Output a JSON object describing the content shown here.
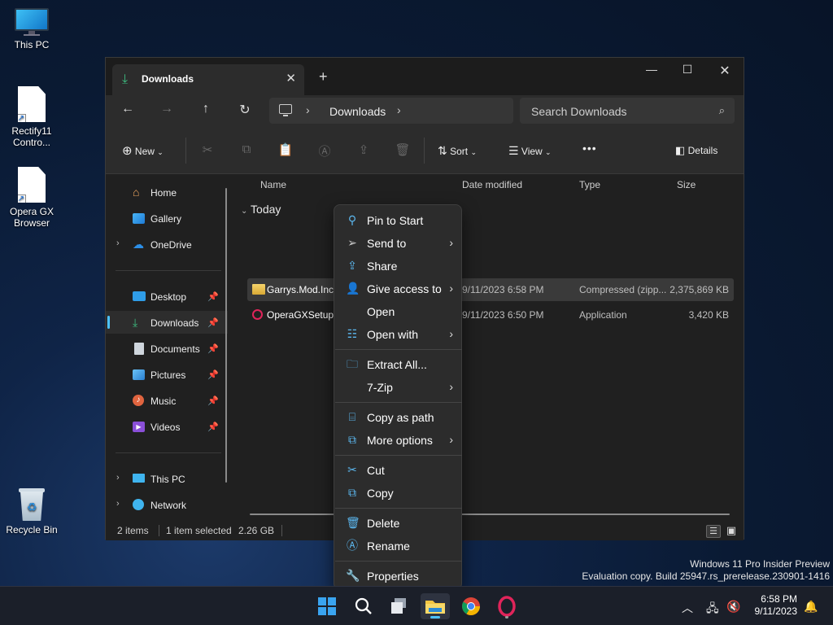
{
  "desktop": {
    "icons": [
      {
        "label": "This PC"
      },
      {
        "label": "Rectify11 Contro..."
      },
      {
        "label": "Opera GX Browser"
      },
      {
        "label": "Recycle Bin"
      }
    ]
  },
  "window": {
    "tab_title": "Downloads",
    "address": {
      "crumb": "Downloads"
    },
    "search_placeholder": "Search Downloads",
    "toolbar": {
      "new_label": "New",
      "sort_label": "Sort",
      "view_label": "View",
      "more_label": "•••",
      "details_label": "Details"
    },
    "sidebar": {
      "items": [
        {
          "label": "Home"
        },
        {
          "label": "Gallery"
        },
        {
          "label": "OneDrive"
        },
        {
          "label": "Desktop"
        },
        {
          "label": "Downloads"
        },
        {
          "label": "Documents"
        },
        {
          "label": "Pictures"
        },
        {
          "label": "Music"
        },
        {
          "label": "Videos"
        },
        {
          "label": "This PC"
        },
        {
          "label": "Network"
        }
      ]
    },
    "columns": {
      "name": "Name",
      "date": "Date modified",
      "type": "Type",
      "size": "Size"
    },
    "group_label": "Today",
    "files": [
      {
        "name": "Garrys.Mod.Inc",
        "date": "9/11/2023 6:58 PM",
        "type": "Compressed (zipp...",
        "size": "2,375,869 KB"
      },
      {
        "name": "OperaGXSetup",
        "date": "9/11/2023 6:50 PM",
        "type": "Application",
        "size": "3,420 KB"
      }
    ],
    "status": {
      "count": "2 items",
      "selected": "1 item selected",
      "size": "2.26 GB"
    }
  },
  "context_menu": {
    "items": [
      {
        "label": "Pin to Start"
      },
      {
        "label": "Send to"
      },
      {
        "label": "Share"
      },
      {
        "label": "Give access to"
      },
      {
        "label": "Open"
      },
      {
        "label": "Open with"
      },
      {
        "label": "Extract All..."
      },
      {
        "label": "7-Zip"
      },
      {
        "label": "Copy as path"
      },
      {
        "label": "More options"
      },
      {
        "label": "Cut"
      },
      {
        "label": "Copy"
      },
      {
        "label": "Delete"
      },
      {
        "label": "Rename"
      },
      {
        "label": "Properties"
      }
    ]
  },
  "watermark": {
    "line1": "Windows 11 Pro Insider Preview",
    "line2": "Evaluation copy. Build 25947.rs_prerelease.230901-1416"
  },
  "taskbar": {
    "time": "6:58 PM",
    "date": "9/11/2023"
  },
  "colors": {
    "accent": "#4cc2ff",
    "downloads_icon": "#3dbb7f",
    "window_bg": "#202020"
  }
}
